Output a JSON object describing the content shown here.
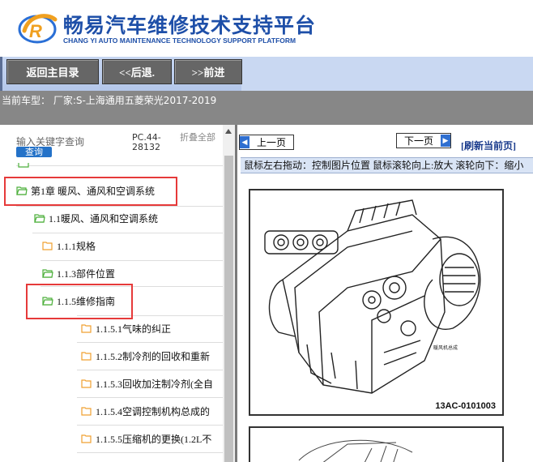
{
  "header": {
    "title": "畅易汽车维修技术支持平台",
    "subtitle": "CHANG YI AUTO MAINTENANCE TECHNOLOGY SUPPORT PLATFORM",
    "logo_icon": "cy-logo-icon"
  },
  "nav": {
    "home": "返回主目录",
    "back": "<<后退.",
    "forward": ">>前进"
  },
  "info": {
    "text": "当前车型： 厂家:S-上海通用五菱荣光2017-2019"
  },
  "sidebar": {
    "search_label": "输入关键字查询",
    "search_button": "查询",
    "pc_label": "PC.44-28132",
    "collapse_label": "折叠全部",
    "tree": [
      {
        "label": "第1章 暖风、通风和空调系统",
        "icon": "folder-open-icon",
        "level": 1
      },
      {
        "label": "1.1暖风、通风和空调系统",
        "icon": "folder-open-icon",
        "level": 2
      },
      {
        "label": "1.1.1规格",
        "icon": "folder-closed-icon",
        "level": 3
      },
      {
        "label": "1.1.3部件位置",
        "icon": "folder-open-icon",
        "level": 3
      },
      {
        "label": "1.1.5维修指南",
        "icon": "folder-open-icon",
        "level": 3
      },
      {
        "label": "1.1.5.1气味的纠正",
        "icon": "folder-closed-icon",
        "level": 4
      },
      {
        "label": "1.1.5.2制冷剂的回收和重新",
        "icon": "folder-closed-icon",
        "level": 4
      },
      {
        "label": "1.1.5.3回收加注制冷剂(全自",
        "icon": "folder-closed-icon",
        "level": 4
      },
      {
        "label": "1.1.5.4空调控制机构总成的",
        "icon": "folder-closed-icon",
        "level": 4
      },
      {
        "label": "1.1.5.5压缩机的更换(1.2L不",
        "icon": "folder-closed-icon",
        "level": 4
      }
    ]
  },
  "viewer": {
    "prev_label": "上一页",
    "next_label": "下一页",
    "refresh_label": "[刷新当前页]",
    "hint": "鼠标左右拖动：控制图片位置 鼠标滚轮向上:放大  滚轮向下：缩小",
    "figure_label": "13AC-0101003",
    "figure_stamp": "暖风机总成"
  },
  "colors": {
    "brand_blue": "#1e4fa8",
    "nav_bg": "#b4c7ea",
    "button_gray": "#666666",
    "info_bg": "#878787",
    "highlight_red": "#e63a3a",
    "folder_green": "#4caf3a",
    "folder_orange": "#f0a030"
  }
}
